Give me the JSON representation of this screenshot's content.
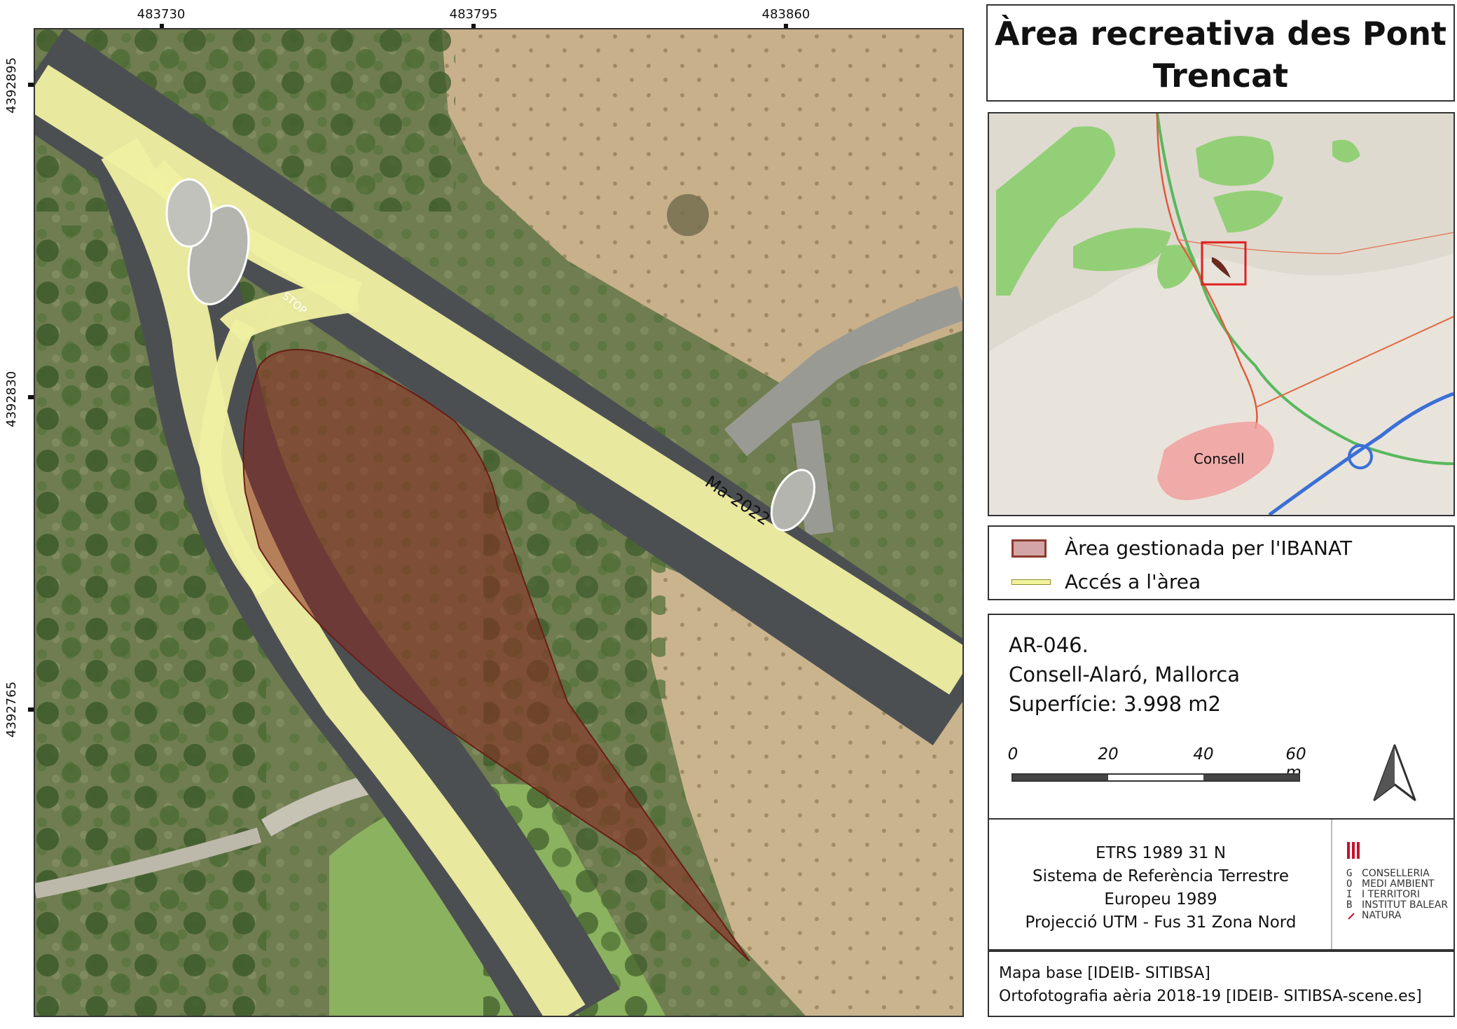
{
  "title": {
    "line1": "Àrea recreativa des Pont",
    "line2": "Trencat"
  },
  "coordinates": {
    "top": [
      "483730",
      "483795",
      "483860"
    ],
    "left": [
      "4392895",
      "4392830",
      "4392765"
    ]
  },
  "map": {
    "road_label": "Ma-2022",
    "stop_marking": "STOP"
  },
  "overview_map": {
    "town_label": "Consell"
  },
  "legend": {
    "area_label": "Àrea gestionada per l'IBANAT",
    "access_label": "Accés a l'àrea",
    "area_color": "#d4a5a8",
    "access_color": "#f2f29a"
  },
  "info": {
    "code": "AR-046.",
    "location": "Consell-Alaró, Mallorca",
    "surface": "Superfície: 3.998 m2"
  },
  "scale": {
    "labels": [
      "0",
      "20",
      "40",
      "60 m"
    ]
  },
  "crs": {
    "line1": "ETRS 1989 31 N",
    "line2": "Sistema de Referència Terrestre",
    "line3": "Europeu 1989",
    "line4": "Projecció UTM - Fus 31 Zona Nord"
  },
  "logo": {
    "goib_letters": [
      "G",
      "O",
      "I",
      "B"
    ],
    "lines": [
      "CONSELLERIA",
      "MEDI AMBIENT",
      "I TERRITORI",
      "INSTITUT BALEAR",
      "NATURA"
    ]
  },
  "sources": {
    "line1": "Mapa base [IDEIB- SITIBSA]",
    "line2": "Ortofotografia aèria 2018-19 [IDEIB- SITIBSA-scene.es]"
  },
  "colors": {
    "frame": "#333333",
    "highlight_box": "#e02020",
    "managed_area_fill": "#8b2a20"
  }
}
